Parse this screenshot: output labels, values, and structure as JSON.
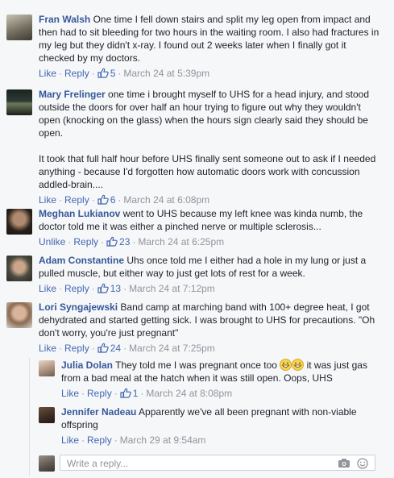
{
  "labels": {
    "like": "Like",
    "unlike": "Unlike",
    "reply": "Reply",
    "sep": "·"
  },
  "comments": [
    {
      "author": "Fran Walsh",
      "text": "One time I fell down stairs and split my leg open from impact and then had to sit bleeding for two hours in the waiting room. I also had fractures in my leg but they didn't x-ray. I found out 2 weeks later when I finally got it checked by my doctors.",
      "likes": "5",
      "time": "March 24 at 5:39pm"
    },
    {
      "author": "Mary Frelinger",
      "text": "one time i brought myself to UHS for a head injury, and stood outside the doors for over half an hour trying to figure out why they wouldn't open (knocking on the glass) when the hours sign clearly said they should be open.",
      "text2": "It took that full half hour before UHS finally sent someone out to ask if I needed anything - because I'd forgotten how automatic doors work with concussion addled-brain....",
      "likes": "6",
      "time": "March 24 at 6:08pm"
    },
    {
      "author": "Meghan Lukianov",
      "text": "went to UHS because my left knee was kinda numb, the doctor told me it was either a pinched nerve or multiple sclerosis...",
      "likes": "23",
      "time": "March 24 at 6:25pm"
    },
    {
      "author": "Adam Constantine",
      "text": "Uhs once told me I either had a hole in my lung or just a pulled muscle, but either way to just get lots of rest for a week.",
      "likes": "13",
      "time": "March 24 at 7:12pm"
    },
    {
      "author": "Lori Syngajewski",
      "text": "Band camp at marching band with 100+ degree heat, I got dehydrated and started getting sick. I was brought to UHS for precautions. \"Oh don't worry, you're just pregnant\"",
      "likes": "24",
      "time": "March 24 at 7:25pm"
    }
  ],
  "replies": [
    {
      "author": "Julia Dolan",
      "text_a": "They told me I was pregnant once too ",
      "text_b": " it was just gas from a bad meal at the hatch when it was still open. Oops, UHS",
      "likes": "1",
      "time": "March 24 at 8:08pm"
    },
    {
      "author": "Jennifer Nadeau",
      "text": "Apparently we've all been pregnant with non-viable offspring",
      "time": "March 29 at 9:54am"
    }
  ],
  "composer": {
    "placeholder": "Write a reply..."
  },
  "colors": {
    "link": "#4267b2",
    "author": "#365899",
    "meta": "#90949c",
    "bg": "#f6f7f9",
    "emoji": "#f7d34a"
  }
}
